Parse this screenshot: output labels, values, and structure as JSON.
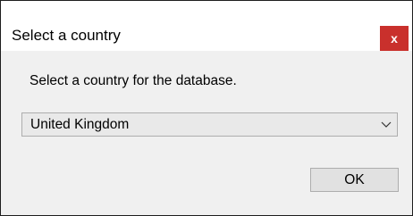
{
  "window": {
    "title": "Select a country",
    "close_label": "x"
  },
  "dialog": {
    "prompt": "Select a country for the database.",
    "country_select": {
      "selected": "United Kingdom"
    },
    "ok_label": "OK"
  },
  "icons": {
    "dropdown": "chevron-down-icon",
    "close": "close-icon"
  },
  "colors": {
    "close_button": "#c9302c",
    "dialog_background": "#f0f0f0"
  }
}
